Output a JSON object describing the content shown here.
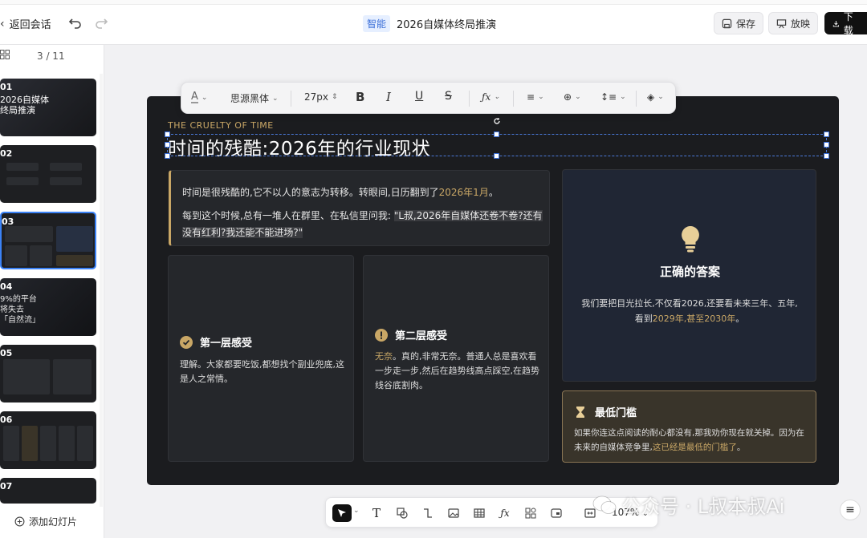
{
  "header": {
    "back_label": "返回会话",
    "badge": "智能",
    "title": "2026自媒体终局推演",
    "save_label": "保存",
    "present_label": "放映",
    "download_label": "下载"
  },
  "sidebar": {
    "page_indicator": "3 / 11",
    "add_slide_label": "添加幻灯片",
    "thumbs": [
      {
        "num": "01",
        "text": "2026自媒体\n终局推演"
      },
      {
        "num": "02",
        "text": ""
      },
      {
        "num": "03",
        "text": ""
      },
      {
        "num": "04",
        "text": "9%的平台\n将失去\n「自然流」"
      },
      {
        "num": "05",
        "text": ""
      },
      {
        "num": "06",
        "text": ""
      },
      {
        "num": "07",
        "text": ""
      }
    ]
  },
  "format_toolbar": {
    "font_family": "思源黑体",
    "font_size": "27px"
  },
  "slide": {
    "eyebrow": "THE CRUELTY OF TIME",
    "title": "时间的残酷:2026年的行业现状",
    "quote": {
      "line1_prefix": "时间是很残酷的,它不以人的意志为转移。转眼间,日历翻到了",
      "line1_highlight": "2026年1月",
      "line1_suffix": "。",
      "line2_prefix": "每到这个时候,总有一堆人在群里、在私信里问我: ",
      "line2_highlight": "\"L叔,2026年自媒体还卷不卷?还有没有红利?我还能不能进场?\""
    },
    "feeling1": {
      "title": "第一层感受",
      "body": "理解。大家都要吃饭,都想找个副业兜底,这是人之常情。"
    },
    "feeling2": {
      "title": "第二层感受",
      "body_highlight": "无奈",
      "body": "。真的,非常无奈。普通人总是喜欢看一步走一步,然后在趋势线高点踩空,在趋势线谷底割肉。"
    },
    "answer": {
      "title": "正确的答案",
      "body_prefix": "我们要把目光拉长,不仅看2026,还要看未来三年、五年,看到",
      "body_highlight": "2029年,甚至2030年",
      "body_suffix": "。"
    },
    "threshold": {
      "title": "最低门槛",
      "body_prefix": "如果你连这点阅读的耐心都没有,那我劝你现在就关掉。因为在未来的自媒体竞争里,",
      "body_highlight": "这已经是最低的门槛了",
      "body_suffix": "。"
    }
  },
  "bottom_toolbar": {
    "zoom": "107%"
  },
  "watermark": "公众号 · L叔本叔Ai",
  "colors": {
    "accent_gold": "#c9a766",
    "slide_bg": "#1b1c1f",
    "selection_blue": "#3b6fd8"
  }
}
